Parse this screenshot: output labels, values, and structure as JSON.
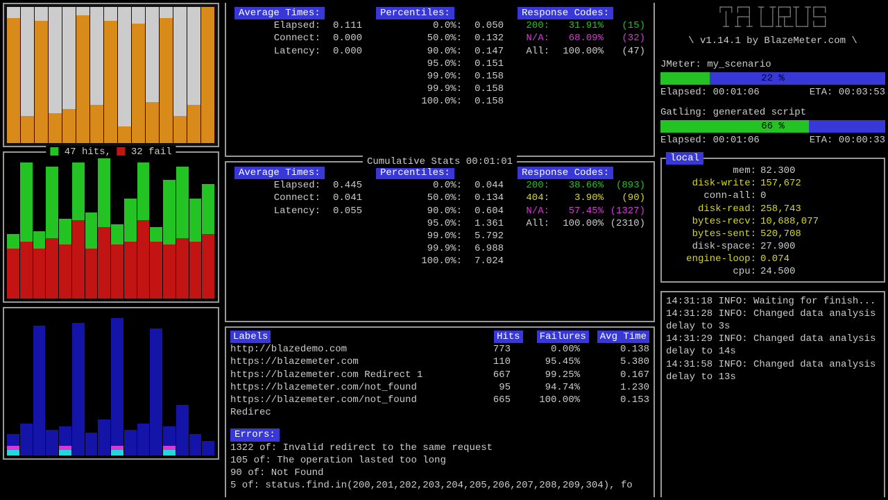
{
  "chart_data": [
    {
      "type": "bar",
      "title": "chart1 stacked bars (orange base + gray top, percentage heights)",
      "series": [
        {
          "name": "orange",
          "values": [
            92,
            20,
            90,
            22,
            25,
            94,
            28,
            90,
            12,
            88,
            30,
            92,
            20,
            28,
            100
          ]
        },
        {
          "name": "gray",
          "values": [
            8,
            80,
            10,
            78,
            75,
            6,
            72,
            10,
            88,
            12,
            70,
            8,
            80,
            72,
            0
          ]
        }
      ]
    },
    {
      "type": "bar",
      "title": "47 hits, 32 fail",
      "series": [
        {
          "name": "fail(red)",
          "values": [
            35,
            40,
            35,
            42,
            38,
            55,
            35,
            50,
            38,
            40,
            55,
            40,
            38,
            42,
            40,
            45
          ]
        },
        {
          "name": "hits(green)",
          "values": [
            10,
            55,
            12,
            50,
            18,
            40,
            25,
            48,
            14,
            30,
            40,
            10,
            45,
            50,
            30,
            35
          ]
        }
      ]
    },
    {
      "type": "bar",
      "title": "chart3 blue/magenta/cyan spikes (percentage heights)",
      "values": [
        15,
        22,
        90,
        18,
        20,
        92,
        16,
        25,
        95,
        18,
        22,
        88,
        20,
        35,
        15,
        10
      ]
    }
  ],
  "interval": {
    "avg_header": "Average Times:",
    "pct_header": "Percentiles:",
    "rc_header": "Response Codes:",
    "avg": [
      {
        "k": "Elapsed:",
        "v": "0.111"
      },
      {
        "k": "Connect:",
        "v": "0.000"
      },
      {
        "k": "Latency:",
        "v": "0.000"
      }
    ],
    "pct": [
      {
        "k": "0.0%:",
        "v": "0.050"
      },
      {
        "k": "50.0%:",
        "v": "0.132"
      },
      {
        "k": "90.0%:",
        "v": "0.147"
      },
      {
        "k": "95.0%:",
        "v": "0.151"
      },
      {
        "k": "99.0%:",
        "v": "0.158"
      },
      {
        "k": "99.9%:",
        "v": "0.158"
      },
      {
        "k": "100.0%:",
        "v": "0.158"
      }
    ],
    "rc": [
      {
        "code": "200:",
        "pct": "31.91%",
        "n": "(15)",
        "cls": "green"
      },
      {
        "code": "N/A:",
        "pct": "68.09%",
        "n": "(32)",
        "cls": "magenta"
      },
      {
        "code": "All:",
        "pct": "100.00%",
        "n": "(47)",
        "cls": "silver"
      }
    ]
  },
  "cum": {
    "title": " Cumulative Stats 00:01:01 ",
    "avg_header": "Average Times:",
    "pct_header": "Percentiles:",
    "rc_header": "Response Codes:",
    "avg": [
      {
        "k": "Elapsed:",
        "v": "0.445"
      },
      {
        "k": "Connect:",
        "v": "0.041"
      },
      {
        "k": "Latency:",
        "v": "0.055"
      }
    ],
    "pct": [
      {
        "k": "0.0%:",
        "v": "0.044"
      },
      {
        "k": "50.0%:",
        "v": "0.134"
      },
      {
        "k": "90.0%:",
        "v": "0.604"
      },
      {
        "k": "95.0%:",
        "v": "1.361"
      },
      {
        "k": "99.0%:",
        "v": "5.792"
      },
      {
        "k": "99.9%:",
        "v": "6.988"
      },
      {
        "k": "100.0%:",
        "v": "7.024"
      }
    ],
    "rc": [
      {
        "code": "200:",
        "pct": "38.66%",
        "n": "(893)",
        "cls": "green"
      },
      {
        "code": "404:",
        "pct": "3.90%",
        "n": "(90)",
        "cls": "yellow"
      },
      {
        "code": "N/A:",
        "pct": "57.45%",
        "n": "(1327)",
        "cls": "magenta"
      },
      {
        "code": "All:",
        "pct": "100.00%",
        "n": "(2310)",
        "cls": "silver"
      }
    ]
  },
  "hits_legend": {
    "hits": "47 hits,",
    "fail": "32 fail"
  },
  "labels": {
    "h_labels": "Labels",
    "h_hits": "Hits",
    "h_fail": "Failures",
    "h_avg": "Avg Time",
    "rows": [
      {
        "l": "http://blazedemo.com",
        "h": "773",
        "f": "0.00%",
        "a": "0.138"
      },
      {
        "l": "https://blazemeter.com",
        "h": "110",
        "f": "95.45%",
        "a": "5.380"
      },
      {
        "l": "https://blazemeter.com Redirect 1",
        "h": "667",
        "f": "99.25%",
        "a": "0.167"
      },
      {
        "l": "https://blazemeter.com/not_found",
        "h": "95",
        "f": "94.74%",
        "a": "1.230"
      },
      {
        "l": "https://blazemeter.com/not_found Redirec",
        "h": "665",
        "f": "100.00%",
        "a": "0.153"
      }
    ]
  },
  "errors": {
    "header": "Errors:",
    "lines": [
      "1322 of: Invalid redirect to the same request",
      "105 of: The operation lasted too long",
      "90 of: Not Found",
      "5 of: status.find.in(200,201,202,203,204,205,206,207,208,209,304), fo"
    ]
  },
  "brand": {
    "name": "Taurus",
    "byline": "\\ v1.14.1 by BlazeMeter.com \\"
  },
  "exec": [
    {
      "name": "JMeter: my_scenario",
      "pct": "22 %",
      "pctn": 22,
      "elapsed": "Elapsed: 00:01:06",
      "eta": "ETA: 00:03:53"
    },
    {
      "name": "Gatling: generated script",
      "pct": "66 %",
      "pctn": 66,
      "elapsed": "Elapsed: 00:01:06",
      "eta": "ETA: 00:00:33"
    }
  ],
  "local": {
    "title": "local",
    "metrics": [
      {
        "k": "mem:",
        "v": "82.300",
        "c": "silver"
      },
      {
        "k": "disk-write:",
        "v": "157,672",
        "c": "yellow"
      },
      {
        "k": "conn-all:",
        "v": "0",
        "c": "silver"
      },
      {
        "k": "disk-read:",
        "v": "258,743",
        "c": "yellow"
      },
      {
        "k": "bytes-recv:",
        "v": "10,688,077",
        "c": "yellow"
      },
      {
        "k": "bytes-sent:",
        "v": "520,708",
        "c": "yellow"
      },
      {
        "k": "disk-space:",
        "v": "27.900",
        "c": "silver"
      },
      {
        "k": "engine-loop:",
        "v": "0.074",
        "c": "yellow"
      },
      {
        "k": "cpu:",
        "v": "24.500",
        "c": "silver"
      }
    ]
  },
  "log": [
    "14:31:18 INFO: Waiting for finish...",
    "14:31:28 INFO: Changed data analysis delay to 3s",
    "14:31:29 INFO: Changed data analysis delay to 14s",
    "14:31:58 INFO: Changed data analysis delay to 13s"
  ]
}
